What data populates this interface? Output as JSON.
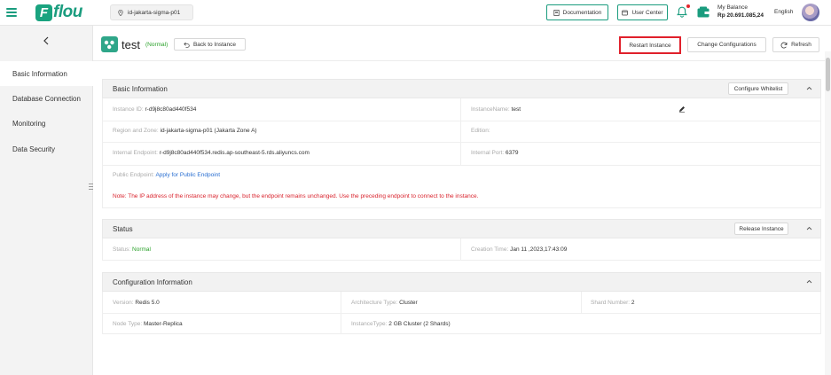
{
  "topbar": {
    "logo_mark": "F",
    "logo_text": "flou",
    "region": "id-jakarta-sigma-p01",
    "documentation": "Documentation",
    "user_center": "User Center",
    "balance_label": "My Balance",
    "balance_amount": "Rp 20.691.085,24",
    "language": "English",
    "accent_color": "#1a9c7e"
  },
  "sidebar": {
    "items": [
      {
        "label": "Basic Information",
        "active": true
      },
      {
        "label": "Database Connection",
        "active": false
      },
      {
        "label": "Monitoring",
        "active": false
      },
      {
        "label": "Data Security",
        "active": false
      }
    ]
  },
  "header": {
    "instance_name": "test",
    "status": "(Normal)",
    "back_label": "Back to Instance",
    "restart_label": "Restart Instance",
    "change_label": "Change Configurations",
    "refresh_label": "Refresh"
  },
  "basic_info": {
    "title": "Basic Information",
    "whitelist_label": "Configure Whitelist",
    "instance_id_key": "Instance ID:",
    "instance_id": "r-d9j8c80ad440f534",
    "instance_name_key": "InstanceName:",
    "instance_name": "test",
    "region_key": "Region and Zone:",
    "region": "id-jakarta-sigma-p01 (Jakarta Zone A)",
    "edition_key": "Edition:",
    "edition": "",
    "endpoint_key": "Internal Endpoint:",
    "endpoint": "r-d9j8c80ad440f534.redis.ap-southeast-5.rds.aliyuncs.com",
    "port_key": "Internal Port:",
    "port": "6379",
    "public_key": "Public Endpoint:",
    "public_link": "Apply for Public Endpoint",
    "note": "Note:  The IP address of the instance may change, but the endpoint remains unchanged. Use the preceding endpoint to connect to the instance."
  },
  "status": {
    "title": "Status",
    "release_label": "Release Instance",
    "status_key": "Status:",
    "status_value": "Normal",
    "created_key": "Creation Time:",
    "created_value": "Jan 11 ,2023,17:43:09"
  },
  "config": {
    "title": "Configuration Information",
    "version_key": "Version:",
    "version": "Redis 5.0",
    "arch_key": "Architecture Type:",
    "arch": "Cluster",
    "shard_key": "Shard Number:",
    "shard": "2",
    "node_key": "Node Type:",
    "node": "Master-Replica",
    "itype_key": "InstanceType:",
    "itype": "2 GB Cluster (2 Shards)"
  }
}
